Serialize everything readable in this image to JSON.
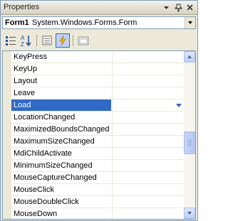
{
  "window": {
    "title": "Properties",
    "pin_icon": "pin-icon",
    "close_icon": "close-icon",
    "menu_icon": "dropdown-arrow-icon"
  },
  "object_selector": {
    "name": "Form1",
    "type": "System.Windows.Forms.Form"
  },
  "toolbar": {
    "buttons": [
      "categorized-icon",
      "alphabetical-icon",
      "properties-icon",
      "events-icon",
      "property-pages-icon"
    ],
    "active": "events-icon"
  },
  "events": [
    {
      "name": "KeyPress",
      "value": ""
    },
    {
      "name": "KeyUp",
      "value": ""
    },
    {
      "name": "Layout",
      "value": ""
    },
    {
      "name": "Leave",
      "value": ""
    },
    {
      "name": "Load",
      "value": "",
      "selected": true
    },
    {
      "name": "LocationChanged",
      "value": ""
    },
    {
      "name": "MaximizedBoundsChanged",
      "value": ""
    },
    {
      "name": "MaximumSizeChanged",
      "value": ""
    },
    {
      "name": "MdiChildActivate",
      "value": ""
    },
    {
      "name": "MinimumSizeChanged",
      "value": ""
    },
    {
      "name": "MouseCaptureChanged",
      "value": ""
    },
    {
      "name": "MouseClick",
      "value": ""
    },
    {
      "name": "MouseDoubleClick",
      "value": ""
    },
    {
      "name": "MouseDown",
      "value": ""
    }
  ],
  "colors": {
    "selection": "#316ac5",
    "chrome": "#ece9d8",
    "border": "#7f9db9"
  }
}
